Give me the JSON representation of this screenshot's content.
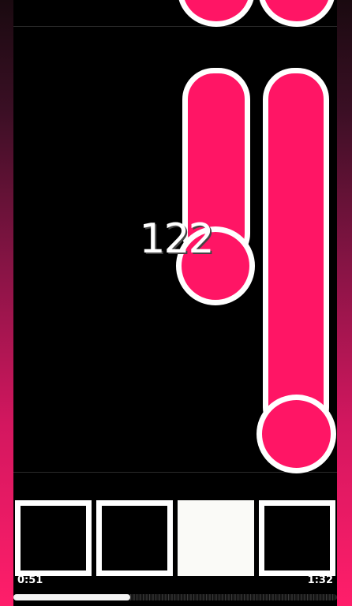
{
  "game": {
    "score": "122",
    "lanes": 4,
    "accent_color": "#ff1565",
    "outline_color": "#ffffff"
  },
  "keys": [
    {
      "lane": 1,
      "state": "idle"
    },
    {
      "lane": 2,
      "state": "idle"
    },
    {
      "lane": 3,
      "state": "pressed"
    },
    {
      "lane": 4,
      "state": "idle"
    }
  ],
  "playback": {
    "current_time": "0:51",
    "total_time": "1:32",
    "progress_fraction": 0.36
  }
}
